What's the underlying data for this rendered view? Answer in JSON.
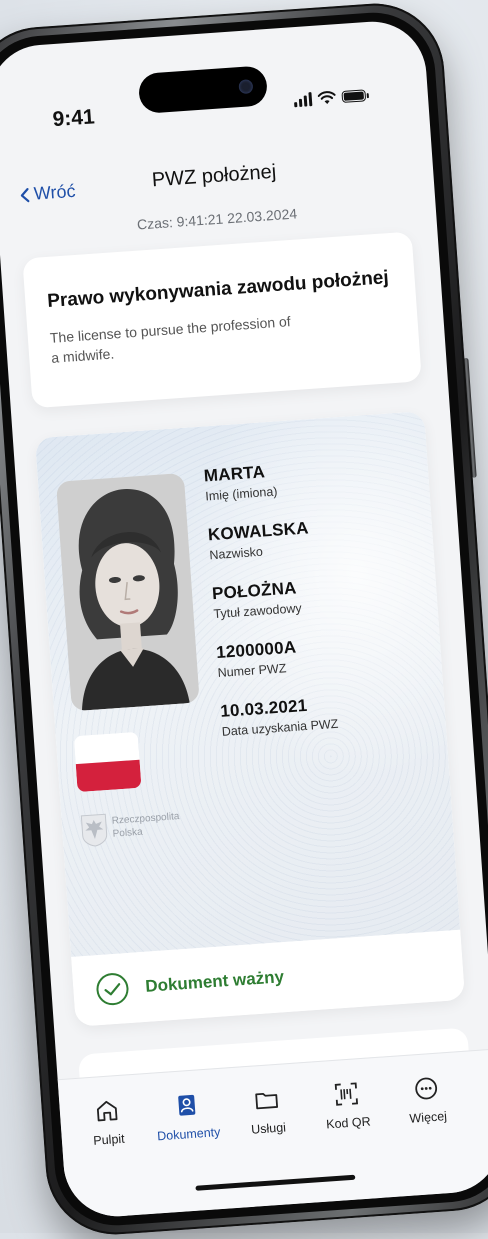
{
  "status_bar": {
    "time": "9:41"
  },
  "nav": {
    "back_label": "Wróć",
    "title": "PWZ położnej"
  },
  "timestamp": "Czas: 9:41:21 22.03.2024",
  "header_card": {
    "title": "Prawo wykonywania zawodu położnej",
    "subtitle": "The license to pursue the profession of a midwife."
  },
  "document": {
    "emblem_text": "Rzeczpospolita Polska",
    "fields": [
      {
        "value": "MARTA",
        "label": "Imię (imiona)"
      },
      {
        "value": "KOWALSKA",
        "label": "Nazwisko"
      },
      {
        "value": "POŁOŻNA",
        "label": "Tytuł zawodowy"
      },
      {
        "value": "1200000A",
        "label": "Numer PWZ"
      },
      {
        "value": "10.03.2021",
        "label": "Data uzyskania PWZ"
      }
    ],
    "status": "Dokument ważny"
  },
  "tabbar": {
    "items": [
      {
        "label": "Pulpit",
        "icon": "home-icon"
      },
      {
        "label": "Dokumenty",
        "icon": "person-card-icon"
      },
      {
        "label": "Usługi",
        "icon": "folder-icon"
      },
      {
        "label": "Kod QR",
        "icon": "qr-scan-icon"
      },
      {
        "label": "Więcej",
        "icon": "more-icon"
      }
    ]
  },
  "colors": {
    "accent": "#1f4fa8",
    "valid": "#2e7d32",
    "flag_red": "#d4213d"
  }
}
